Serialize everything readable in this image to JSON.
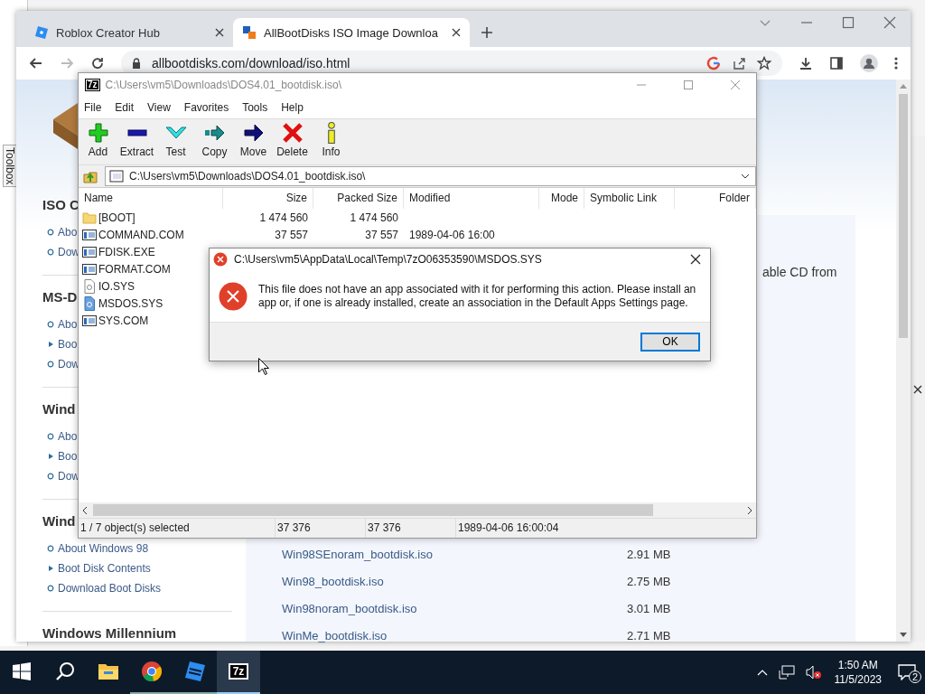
{
  "desktop": {
    "side_label": "Toolbox"
  },
  "browser": {
    "tabs": [
      {
        "title": "Roblox Creator Hub",
        "kind": "roblox",
        "selected": false
      },
      {
        "title": "AllBootDisks ISO Image Downloa",
        "kind": "site",
        "selected": true
      }
    ],
    "forward_disabled": true,
    "address": "allbootdisks.com/download/iso.html"
  },
  "page": {
    "sidebar": [
      {
        "heading": "ISO C",
        "links": [
          {
            "text": "Abo",
            "kind": "bullet"
          },
          {
            "text": "Dow",
            "kind": "bullet"
          }
        ]
      },
      {
        "heading": "MS-D",
        "links": [
          {
            "text": "Abo",
            "kind": "bullet"
          },
          {
            "text": "Boo",
            "kind": "arrow"
          },
          {
            "text": "Dow",
            "kind": "bullet"
          }
        ]
      },
      {
        "heading": "Wind",
        "links": [
          {
            "text": "Abo",
            "kind": "bullet"
          },
          {
            "text": "Boo",
            "kind": "arrow"
          },
          {
            "text": "Dow",
            "kind": "bullet"
          }
        ]
      },
      {
        "heading": "Wind",
        "links": [
          {
            "text": "About Windows 98",
            "kind": "bullet"
          },
          {
            "text": "Boot Disk Contents",
            "kind": "arrow"
          },
          {
            "text": "Download Boot Disks",
            "kind": "bullet"
          }
        ]
      },
      {
        "heading": "Windows Millennium"
      }
    ],
    "intro_text": "able CD from",
    "downloads": [
      {
        "file": "Win98SEnoram_bootdisk.iso",
        "size": "2.91 MB"
      },
      {
        "file": "Win98_bootdisk.iso",
        "size": "2.75 MB"
      },
      {
        "file": "Win98noram_bootdisk.iso",
        "size": "3.01 MB"
      },
      {
        "file": "WinMe_bootdisk.iso",
        "size": "2.71 MB"
      }
    ]
  },
  "archiver": {
    "logo": "7z",
    "title": "C:\\Users\\vm5\\Downloads\\DOS4.01_bootdisk.iso\\",
    "menu": [
      "File",
      "Edit",
      "View",
      "Favorites",
      "Tools",
      "Help"
    ],
    "toolbar": [
      {
        "label": "Add",
        "kind": "add"
      },
      {
        "label": "Extract",
        "kind": "extract"
      },
      {
        "label": "Test",
        "kind": "test"
      },
      {
        "label": "Copy",
        "kind": "copy"
      },
      {
        "label": "Move",
        "kind": "move"
      },
      {
        "label": "Delete",
        "kind": "delete"
      },
      {
        "label": "Info",
        "kind": "info"
      }
    ],
    "path": "C:\\Users\\vm5\\Downloads\\DOS4.01_bootdisk.iso\\",
    "columns": [
      "Name",
      "Size",
      "Packed Size",
      "Modified",
      "Mode",
      "Symbolic Link",
      "Folder"
    ],
    "rows": [
      {
        "name": "[BOOT]",
        "kind": "folder",
        "size": "1 474 560",
        "packed": "1 474 560"
      },
      {
        "name": "COMMAND.COM",
        "kind": "app",
        "size": "37 557",
        "packed": "37 557",
        "modified": "1989-04-06 16:00"
      },
      {
        "name": "FDISK.EXE",
        "kind": "app"
      },
      {
        "name": "FORMAT.COM",
        "kind": "app"
      },
      {
        "name": "IO.SYS",
        "kind": "doc"
      },
      {
        "name": "MSDOS.SYS",
        "kind": "docblue"
      },
      {
        "name": "SYS.COM",
        "kind": "app"
      }
    ],
    "status": [
      "1 / 7 object(s) selected",
      "37 376",
      "37 376",
      "1989-04-06 16:00:04"
    ]
  },
  "dialog": {
    "title": "C:\\Users\\vm5\\AppData\\Local\\Temp\\7zO06353590\\MSDOS.SYS",
    "message": "This file does not have an app associated with it for performing this action. Please install an app or, if one is already installed, create an association in the Default Apps Settings page.",
    "button": "OK"
  },
  "taskbar": {
    "apps": [
      {
        "kind": "start",
        "running": false,
        "active": false
      },
      {
        "kind": "search",
        "running": false,
        "active": false
      },
      {
        "kind": "explorer",
        "running": false,
        "active": false
      },
      {
        "kind": "chrome",
        "running": true,
        "active": false
      },
      {
        "kind": "roblox",
        "running": true,
        "active": false
      },
      {
        "kind": "archiver",
        "logo": "7z",
        "running": true,
        "active": true
      }
    ],
    "time": "1:50 AM",
    "date": "11/5/2023",
    "notifications": "2"
  }
}
